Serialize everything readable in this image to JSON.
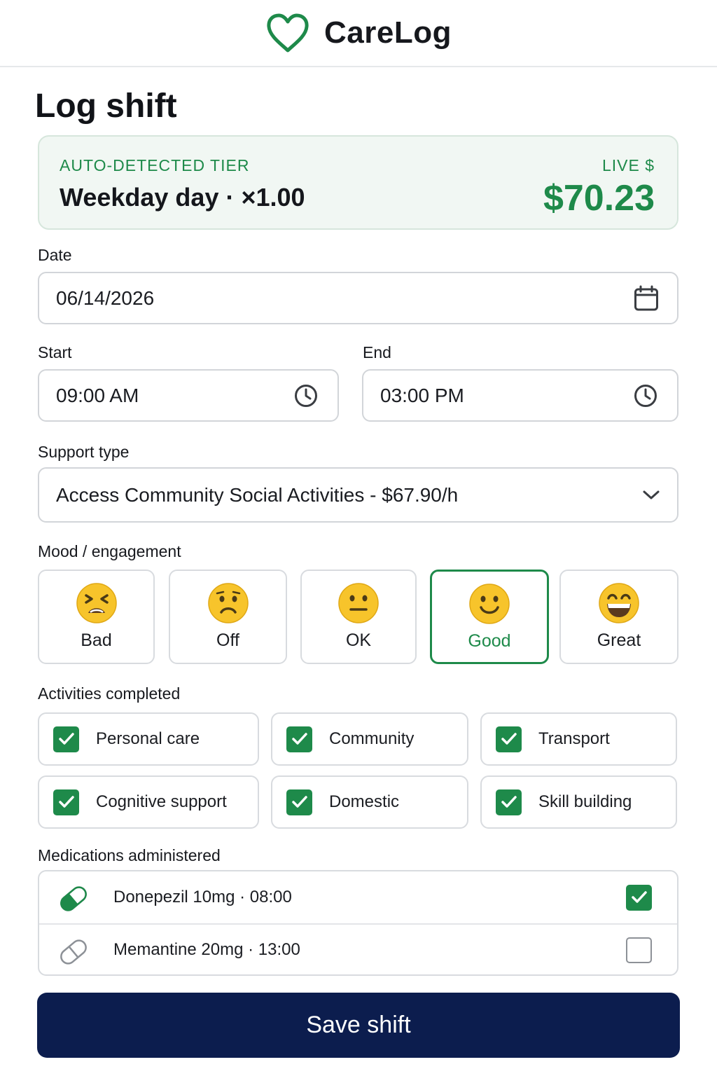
{
  "app": {
    "name": "CareLog",
    "logo_icon": "heart-outline-icon",
    "accent": "#1e8a4a",
    "primary": "#0c1d4e"
  },
  "page": {
    "title": "Log shift"
  },
  "tier": {
    "label": "AUTO-DETECTED TIER",
    "value": "Weekday day · ×1.00",
    "live_label": "LIVE $",
    "live_value": "$70.23"
  },
  "date": {
    "label": "Date",
    "value": "06/14/2026",
    "icon": "calendar-icon"
  },
  "start": {
    "label": "Start",
    "value": "09:00 AM",
    "icon": "clock-icon"
  },
  "end": {
    "label": "End",
    "value": "03:00 PM",
    "icon": "clock-icon"
  },
  "support": {
    "label": "Support type",
    "value": "Access Community Social Activities - $67.90/h",
    "icon": "chevron-down-icon"
  },
  "mood": {
    "label": "Mood / engagement",
    "options": [
      {
        "label": "Bad",
        "icon": "tired-face-emoji",
        "selected": false
      },
      {
        "label": "Off",
        "icon": "frowning-face-emoji",
        "selected": false
      },
      {
        "label": "OK",
        "icon": "neutral-face-emoji",
        "selected": false
      },
      {
        "label": "Good",
        "icon": "slightly-smiling-face-emoji",
        "selected": true
      },
      {
        "label": "Great",
        "icon": "grinning-face-emoji",
        "selected": false
      }
    ]
  },
  "activities": {
    "label": "Activities completed",
    "items": [
      {
        "label": "Personal care",
        "checked": true
      },
      {
        "label": "Community",
        "checked": true
      },
      {
        "label": "Transport",
        "checked": true
      },
      {
        "label": "Cognitive support",
        "checked": true
      },
      {
        "label": "Domestic",
        "checked": true
      },
      {
        "label": "Skill building",
        "checked": true
      }
    ]
  },
  "medications": {
    "label": "Medications administered",
    "items": [
      {
        "text": "Donepezil 10mg · 08:00",
        "icon": "pill-filled-icon",
        "checked": true
      },
      {
        "text": "Memantine 20mg · 13:00",
        "icon": "pill-outline-icon",
        "checked": false
      }
    ]
  },
  "save": {
    "label": "Save shift"
  }
}
